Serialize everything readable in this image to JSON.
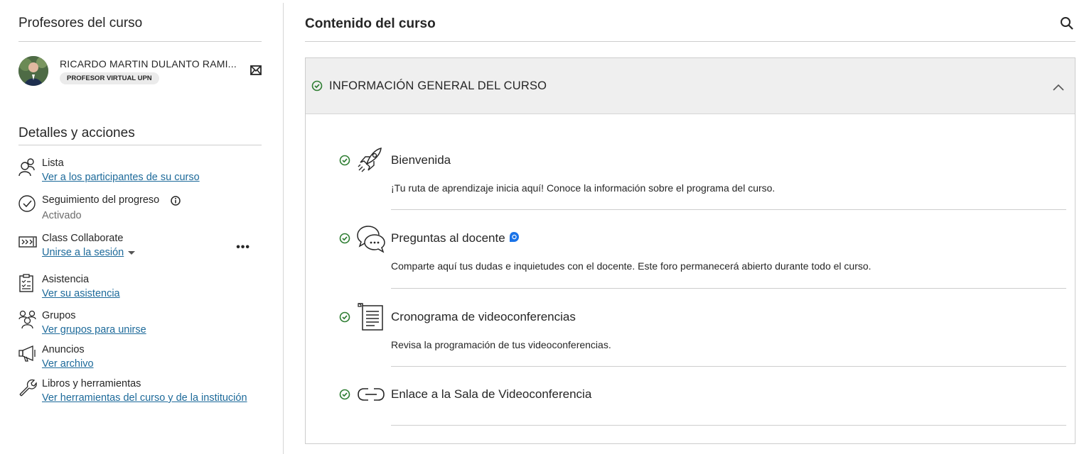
{
  "left": {
    "instructors_title": "Profesores del curso",
    "instructor": {
      "name": "RICARDO MARTIN DULANTO RAMI...",
      "role_badge": "PROFESOR VIRTUAL UPN"
    },
    "details_title": "Detalles y acciones",
    "items": [
      {
        "title": "Lista",
        "link": "Ver a los participantes de su curso",
        "icon": "roster-icon"
      },
      {
        "title": "Seguimiento del progreso",
        "status": "Activado",
        "icon": "progress-check-icon"
      },
      {
        "title": "Class Collaborate",
        "link": "Unirse a la sesión",
        "icon": "collaborate-icon",
        "more": "•••"
      },
      {
        "title": "Asistencia",
        "link": "Ver su asistencia",
        "icon": "attendance-icon"
      },
      {
        "title": "Grupos",
        "link": "Ver grupos para unirse",
        "icon": "groups-icon"
      },
      {
        "title": "Anuncios",
        "link": "Ver archivo",
        "icon": "megaphone-icon"
      },
      {
        "title": "Libros y herramientas",
        "link": "Ver herramientas del curso y de la institución",
        "icon": "wrench-icon"
      }
    ]
  },
  "content": {
    "title": "Contenido del curso",
    "folder": {
      "title": "INFORMACIÓN GENERAL DEL CURSO",
      "items": [
        {
          "title": "Bienvenida",
          "description": "¡Tu ruta de aprendizaje inicia aquí! Conoce la información sobre el programa del curso.",
          "icon": "rocket-icon"
        },
        {
          "title": "Preguntas al docente",
          "description": "Comparte aquí tus dudas e inquietudes con el docente. Este foro permanecerá abierto durante todo el curso.",
          "icon": "discussion-icon"
        },
        {
          "title": "Cronograma de videoconferencias",
          "description": "Revisa la programación de tus videoconferencias.",
          "icon": "document-icon"
        },
        {
          "title": "Enlace a la Sala de Videoconferencia",
          "description": "",
          "icon": "link-icon"
        }
      ]
    }
  },
  "colors": {
    "link": "#1d6a9a",
    "check": "#2e7d32",
    "accent_blue": "#1a73e8",
    "folder_bg": "#efefef"
  }
}
